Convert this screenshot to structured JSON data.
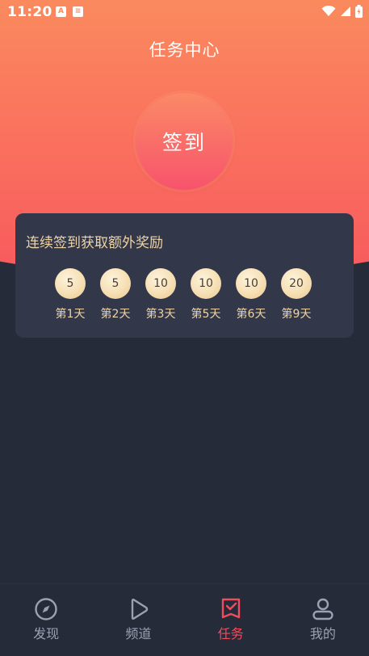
{
  "status_bar": {
    "time": "11:20",
    "left_icons": [
      "a-icon",
      "book-icon"
    ],
    "right_icons": [
      "wifi-icon",
      "signal-icon",
      "battery-icon"
    ]
  },
  "header": {
    "title": "任务中心"
  },
  "checkin": {
    "label": "签到"
  },
  "reward_card": {
    "title": "连续签到获取额外奖励",
    "items": [
      {
        "value": "5",
        "day": "第1天"
      },
      {
        "value": "5",
        "day": "第2天"
      },
      {
        "value": "10",
        "day": "第3天"
      },
      {
        "value": "10",
        "day": "第5天"
      },
      {
        "value": "10",
        "day": "第6天"
      },
      {
        "value": "20",
        "day": "第9天"
      }
    ]
  },
  "bottom_nav": {
    "items": [
      {
        "label": "发现",
        "icon": "compass-icon",
        "active": false
      },
      {
        "label": "频道",
        "icon": "play-icon",
        "active": false
      },
      {
        "label": "任务",
        "icon": "task-icon",
        "active": true
      },
      {
        "label": "我的",
        "icon": "user-icon",
        "active": false
      }
    ]
  },
  "colors": {
    "accent": "#f24b5e",
    "gold_text": "#efd3a4",
    "background": "#262b39",
    "card": "#323849",
    "nav_inactive": "#9aa1b3"
  }
}
